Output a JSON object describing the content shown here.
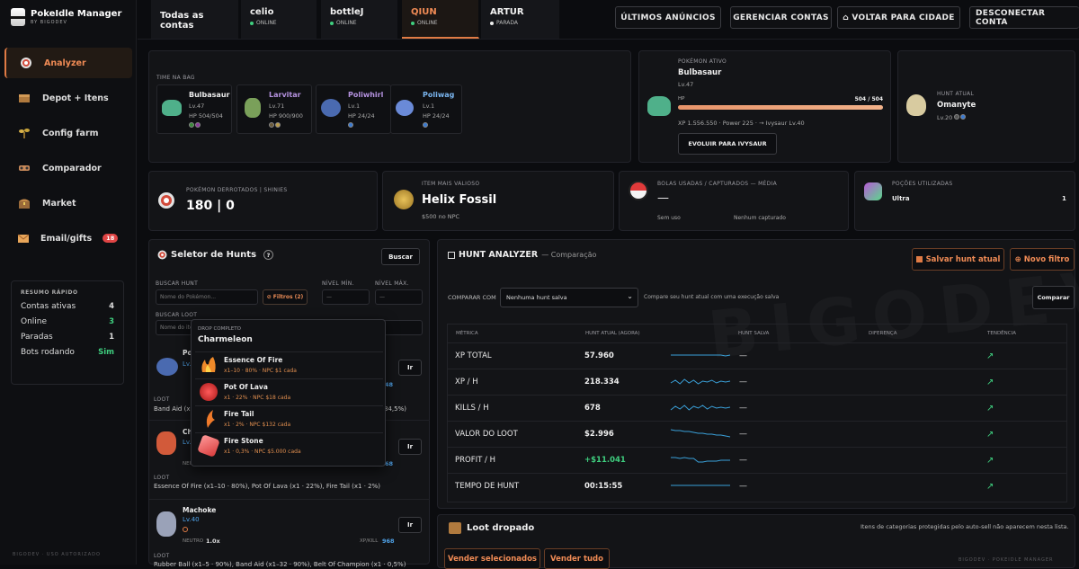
{
  "sidebar": {
    "brand_title": "PokeIdle Manager",
    "brand_sub": "BY BIGODEV",
    "items": [
      {
        "label": "Analyzer",
        "icon": "target-icon",
        "active": true
      },
      {
        "label": "Depot + Itens",
        "icon": "box-icon"
      },
      {
        "label": "Config farm",
        "icon": "plant-icon"
      },
      {
        "label": "Comparador",
        "icon": "compare-icon"
      },
      {
        "label": "Market",
        "icon": "chest-icon"
      },
      {
        "label": "Email/gifts",
        "icon": "mail-icon",
        "badge": "18"
      }
    ],
    "summary": {
      "title": "RESUMO RÁPIDO",
      "rows": [
        {
          "label": "Contas ativas",
          "value": "4"
        },
        {
          "label": "Online",
          "value": "3"
        },
        {
          "label": "Paradas",
          "value": "1"
        },
        {
          "label": "Bots rodando",
          "value": "Sim"
        }
      ]
    },
    "footer": "BIGODEV · USO AUTORIZADO"
  },
  "topbar": {
    "accounts": [
      {
        "name": "Todas as contas",
        "status": ""
      },
      {
        "name": "celio",
        "status": "ONLINE"
      },
      {
        "name": "bottleJ",
        "status": "ONLINE"
      },
      {
        "name": "QIUN",
        "status": "ONLINE"
      },
      {
        "name": "ARTUR",
        "status": "PARADA"
      }
    ],
    "buttons": [
      "ÚLTIMOS ANÚNCIOS",
      "GERENCIAR CONTAS",
      "⌂ VOLTAR PARA CIDADE",
      "DESCONECTAR CONTA"
    ]
  },
  "team": {
    "label": "TIME NA BAG",
    "pokemon": [
      {
        "name": "Bulbasaur",
        "lv": "Lv.47",
        "hp": "HP 504/504"
      },
      {
        "name": "Larvitar",
        "lv": "Lv.71",
        "hp": "HP 900/900"
      },
      {
        "name": "Poliwhirl",
        "lv": "Lv.1",
        "hp": "HP 24/24"
      },
      {
        "name": "Poliwag",
        "lv": "Lv.1",
        "hp": "HP 24/24"
      }
    ]
  },
  "active": {
    "label": "POKÉMON ATIVO",
    "name": "Bulbasaur",
    "lv": "Lv.47",
    "hp_label": "HP",
    "hp_value": "504 / 504",
    "hp_fraction": 1.0,
    "xp_line": "XP 1.556.550 · Power 225 · → Ivysaur Lv.40",
    "evolve_button": "EVOLUIR PARA IVYSAUR"
  },
  "current_hunt": {
    "label": "HUNT ATUAL",
    "name": "Omanyte",
    "lv": "Lv.20"
  },
  "stats": {
    "defeated_label": "POKÉMON DERROTADOS | SHINIES",
    "defeated_value": "180 | 0",
    "item_label": "ITEM MAIS VALIOSO",
    "item_name": "Helix Fossil",
    "item_price": "$500 no NPC",
    "balls_label": "BOLAS USADAS / CAPTURADOS — MÉDIA",
    "balls_value": "—",
    "balls_used": "Sem uso",
    "balls_caught": "Nenhum capturado",
    "potions_label": "POÇÕES UTILIZADAS",
    "potion_name": "Ultra",
    "potion_count": "1"
  },
  "selector": {
    "title": "Seletor de Hunts",
    "help": "?",
    "search_button": "Buscar",
    "hunt_label": "BUSCAR HUNT",
    "hunt_placeholder": "Nome do Pokémon...",
    "filters_button": "⊘ Filtros (2)",
    "min_label": "NÍVEL MÍN.",
    "max_label": "NÍVEL MÁX.",
    "min_placeholder": "—",
    "max_placeholder": "—",
    "loot_label": "BUSCAR LOOT",
    "loot_placeholder": "Nome do item...",
    "go_label": "Ir",
    "loot_word": "LOOT",
    "neutral_word": "NEUTRO",
    "xpkill_word": "XP/KILL",
    "hunts": [
      {
        "name": "Po",
        "lv": "Lv.",
        "xpkill": "48",
        "loot": "Band Aid (x",
        "loot_tail": "34,5%)"
      },
      {
        "name": "Ch",
        "lv": "Lv.",
        "xpkill": "68",
        "loot": "Essence Of Fire (x1–10 · 80%), Pot Of Lava (x1 · 22%), Fire Tail (x1 · 2%)",
        "neutral": "NEU"
      },
      {
        "name": "Machoke",
        "lv": "Lv.40",
        "xpkill": "968",
        "neutral_value": "1.0x",
        "loot": "Rubber Ball (x1–5 · 90%), Band Aid (x1–32 · 90%), Belt Of Champion (x1 · 0,5%)"
      }
    ]
  },
  "dropdown": {
    "label": "DROP COMPLETO",
    "title": "Charmeleon",
    "items": [
      {
        "name": "Essence Of Fire",
        "detail": "x1–10 · 80% · NPC $1 cada"
      },
      {
        "name": "Pot Of Lava",
        "detail": "x1 · 22% · NPC $18 cada"
      },
      {
        "name": "Fire Tail",
        "detail": "x1 · 2% · NPC $132 cada"
      },
      {
        "name": "Fire Stone",
        "detail": "x1 · 0,3% · NPC $5.000 cada"
      }
    ]
  },
  "analyzer": {
    "title": "HUNT ANALYZER",
    "subtitle": "— Comparação",
    "save_button": "Salvar hunt atual",
    "new_filter_button": "Novo filtro",
    "compare_label": "COMPARAR COM",
    "compare_selected": "Nenhuma hunt salva",
    "compare_hint": "Compare seu hunt atual com uma execução salva",
    "compare_button": "Comparar",
    "headers": [
      "MÉTRICA",
      "HUNT ATUAL (AGORA)",
      "HUNT SALVA",
      "DIFERENÇA",
      "TENDÊNCIA"
    ],
    "rows": [
      {
        "metric": "XP TOTAL",
        "current": "57.960",
        "saved": "—",
        "trend": "↗",
        "spark": [
          6,
          6,
          6,
          6,
          6,
          6,
          6,
          6,
          6,
          6,
          6,
          6,
          5,
          6
        ]
      },
      {
        "metric": "XP / H",
        "current": "218.334",
        "saved": "—",
        "trend": "↗",
        "spark": [
          4,
          7,
          3,
          8,
          4,
          7,
          3,
          6,
          5,
          7,
          4,
          6,
          5,
          6
        ]
      },
      {
        "metric": "KILLS / H",
        "current": "678",
        "saved": "—",
        "trend": "↗",
        "spark": [
          3,
          7,
          4,
          8,
          3,
          7,
          5,
          8,
          4,
          7,
          5,
          6,
          5,
          6
        ]
      },
      {
        "metric": "VALOR DO LOOT",
        "current": "$2.996",
        "saved": "—",
        "trend": "↗",
        "spark": [
          10,
          9,
          9,
          8,
          8,
          7,
          6,
          6,
          5,
          5,
          4,
          4,
          3,
          2
        ]
      },
      {
        "metric": "PROFIT / H",
        "current": "+$11.041",
        "saved": "—",
        "trend": "↗",
        "spark": [
          8,
          8,
          7,
          8,
          7,
          7,
          3,
          3,
          4,
          4,
          4,
          5,
          5,
          5
        ]
      },
      {
        "metric": "TEMPO DE HUNT",
        "current": "00:15:55",
        "saved": "—",
        "trend": "↗",
        "spark": [
          6,
          6,
          6,
          6,
          6,
          6,
          6,
          6,
          6,
          6,
          6,
          6,
          6,
          6
        ]
      }
    ]
  },
  "loot": {
    "title": "Loot dropado",
    "hint": "Itens de categorias protegidas pelo auto-sell não aparecem nesta lista.",
    "sell_selected": "Vender selecionados",
    "sell_all": "Vender tudo"
  },
  "watermark": "BIGODEV",
  "footer_right": "BIGODEV · POKEIDLE MANAGER",
  "colors": {
    "accent": "#e07b45",
    "online": "#3fcf7f",
    "danger": "#e04545",
    "link": "#4fa2e8"
  }
}
